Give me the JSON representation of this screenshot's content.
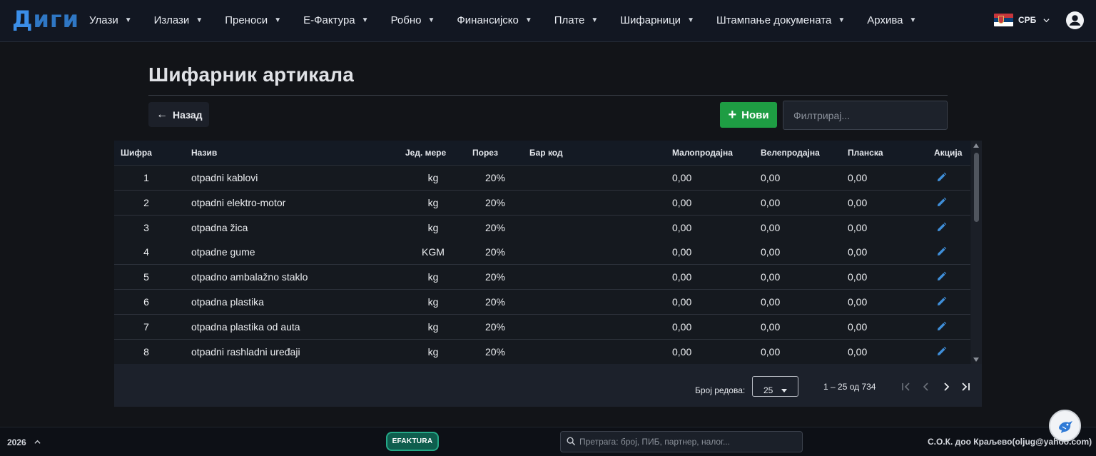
{
  "app": {
    "logo_first": "Д",
    "logo_rest": "иги"
  },
  "nav": {
    "items": [
      {
        "label": "Улази"
      },
      {
        "label": "Излази"
      },
      {
        "label": "Преноси"
      },
      {
        "label": "Е-Фактура"
      },
      {
        "label": "Робно"
      },
      {
        "label": "Финансијско"
      },
      {
        "label": "Плате"
      },
      {
        "label": "Шифарници"
      },
      {
        "label": "Штампање докумената"
      },
      {
        "label": "Архива"
      }
    ],
    "language": "СРБ",
    "flag_icon": "serbian-flag-icon",
    "user_icon": "account-circle-icon"
  },
  "page": {
    "title": "Шифарник артикала",
    "back_label": "Назад",
    "new_label": "Нови",
    "filter_placeholder": "Филтрирај..."
  },
  "table": {
    "columns": [
      "Шифра",
      "Назив",
      "Јед. мере",
      "Порез",
      "Бар код",
      "Малопродајна",
      "Велепродајна",
      "Планска",
      "Акција"
    ],
    "rows": [
      {
        "code": "1",
        "name": "otpadni kablovi",
        "unit": "kg",
        "tax": "20%",
        "barcode": "",
        "retail": "0,00",
        "wholesale": "0,00",
        "planned": "0,00"
      },
      {
        "code": "2",
        "name": "otpadni elektro-motor",
        "unit": "kg",
        "tax": "20%",
        "barcode": "",
        "retail": "0,00",
        "wholesale": "0,00",
        "planned": "0,00"
      },
      {
        "code": "3",
        "name": "otpadna žica",
        "unit": "kg",
        "tax": "20%",
        "barcode": "",
        "retail": "0,00",
        "wholesale": "0,00",
        "planned": "0,00"
      },
      {
        "code": "4",
        "name": "otpadne gume",
        "unit": "KGM",
        "tax": "20%",
        "barcode": "",
        "retail": "0,00",
        "wholesale": "0,00",
        "planned": "0,00"
      },
      {
        "code": "5",
        "name": "otpadno ambalažno staklo",
        "unit": "kg",
        "tax": "20%",
        "barcode": "",
        "retail": "0,00",
        "wholesale": "0,00",
        "planned": "0,00"
      },
      {
        "code": "6",
        "name": "otpadna plastika",
        "unit": "kg",
        "tax": "20%",
        "barcode": "",
        "retail": "0,00",
        "wholesale": "0,00",
        "planned": "0,00"
      },
      {
        "code": "7",
        "name": "otpadna plastika od auta",
        "unit": "kg",
        "tax": "20%",
        "barcode": "",
        "retail": "0,00",
        "wholesale": "0,00",
        "planned": "0,00"
      },
      {
        "code": "8",
        "name": "otpadni rashladni uređaji",
        "unit": "kg",
        "tax": "20%",
        "barcode": "",
        "retail": "0,00",
        "wholesale": "0,00",
        "planned": "0,00"
      }
    ],
    "action_icon": "pencil-edit-icon"
  },
  "paginator": {
    "rows_label": "Број редова:",
    "page_size": "25",
    "range": "1 – 25 од 734"
  },
  "footer": {
    "year": "2026",
    "efaktura_label": "EFAKTURA",
    "search_placeholder": "Претрага: број, ПИБ, партнер, налог...",
    "company": "С.О.К. доо Краљево(oljug@yahoo.com)"
  },
  "colors": {
    "accent_blue": "#3b8ee8",
    "new_button": "#1e9d43",
    "edit_icon": "#3f8ed8",
    "efaktura": "#24a887"
  }
}
